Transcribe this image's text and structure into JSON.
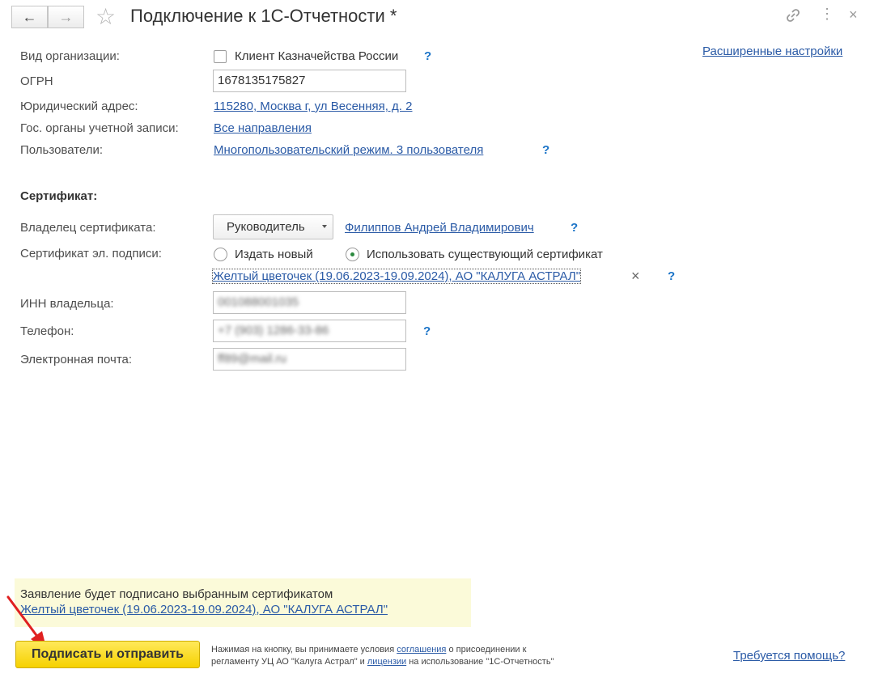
{
  "header": {
    "title": "Подключение к 1С-Отчетности *",
    "back_icon": "←",
    "forward_icon": "→",
    "star_icon": "☆",
    "link_icon": "🔗",
    "more_icon": "⋮",
    "close_icon": "×"
  },
  "advanced_settings": "Расширенные настройки",
  "form": {
    "org_type_label": "Вид организации:",
    "treasury_client_label": "Клиент Казначейства России",
    "ogrn_label": "ОГРН",
    "ogrn_value": "1678135175827",
    "legal_address_label": "Юридический адрес:",
    "legal_address_value": "115280, Москва г, ул Весенняя, д. 2",
    "gov_bodies_label": "Гос. органы учетной записи:",
    "gov_bodies_value": "Все направления",
    "users_label": "Пользователи:",
    "users_value": "Многопользовательский режим. 3 пользователя",
    "help": "?"
  },
  "certificate": {
    "section_title": "Сертификат:",
    "owner_label": "Владелец сертификата:",
    "owner_role": "Руководитель",
    "owner_name": "Филиппов Андрей Владимирович",
    "signature_label": "Сертификат эл. подписи:",
    "issue_new_label": "Издать новый",
    "use_existing_label": "Использовать существующий сертификат",
    "selected_cert": "Желтый цветочек (19.06.2023-19.09.2024), АО \"КАЛУГА АСТРАЛ\"",
    "clear_icon": "×",
    "inn_label": "ИНН владельца:",
    "inn_value": "001088001035",
    "phone_label": "Телефон:",
    "phone_value": "+7 (903) 1286-33-86",
    "email_label": "Электронная почта:",
    "email_value": "ff89@mail.ru"
  },
  "notice": {
    "text": "Заявление будет подписано выбранным сертификатом",
    "cert_link": "Желтый цветочек (19.06.2023-19.09.2024), АО \"КАЛУГА АСТРАЛ\""
  },
  "footer": {
    "submit_label": "Подписать и отправить",
    "terms_part1": "Нажимая на кнопку, вы принимаете условия ",
    "terms_agreement": "соглашения",
    "terms_part2": " о присоединении к",
    "terms_part3": "регламенту УЦ АО \"Калуга Астрал\" и ",
    "terms_licenses": "лицензии",
    "terms_part4": " на использование \"1С-Отчетность\"",
    "help_link": "Требуется помощь?"
  },
  "colors": {
    "link": "#2a5aa6",
    "help": "#1a73c7",
    "submit_button": "#f6d100",
    "notice_background": "#fbfad9",
    "arrow": "#e02020"
  }
}
